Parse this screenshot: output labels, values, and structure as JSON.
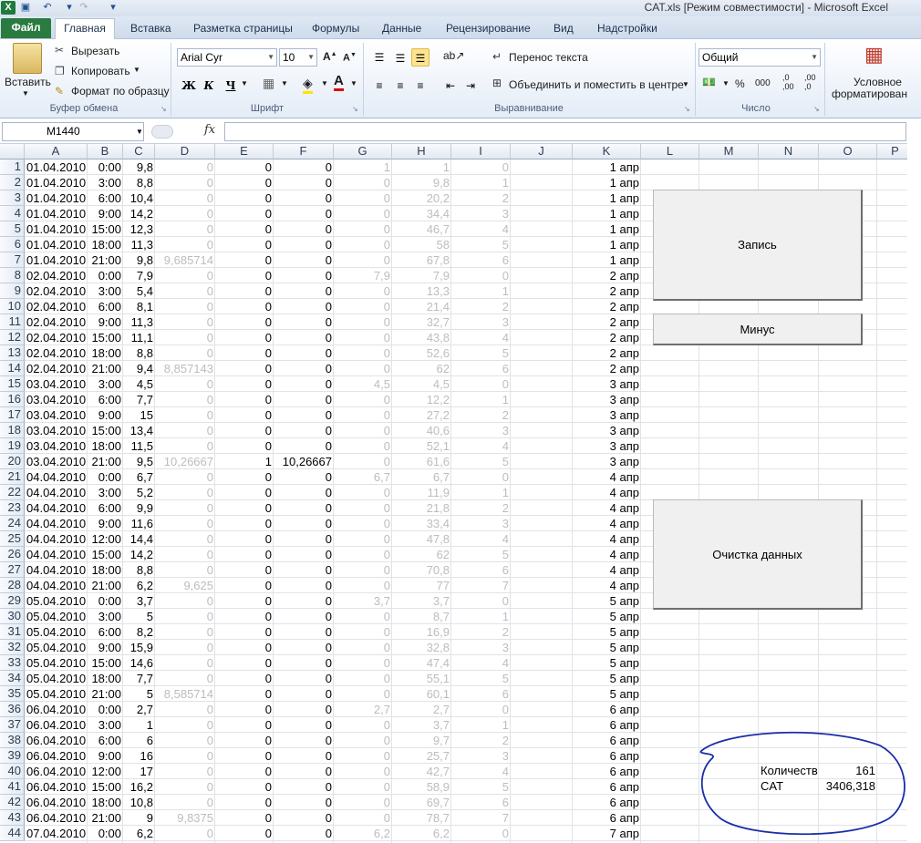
{
  "window": {
    "title": "CAT.xls  [Режим совместимости]  -  Microsoft Excel"
  },
  "ribbon": {
    "tabs": [
      "Файл",
      "Главная",
      "Вставка",
      "Разметка страницы",
      "Формулы",
      "Данные",
      "Рецензирование",
      "Вид",
      "Надстройки"
    ],
    "clipboard": {
      "paste": "Вставить",
      "cut": "Вырезать",
      "copy": "Копировать",
      "format_painter": "Формат по образцу",
      "group": "Буфер обмена"
    },
    "font": {
      "name": "Arial Cyr",
      "size": "10",
      "bold": "Ж",
      "italic": "К",
      "underline": "Ч",
      "group": "Шрифт"
    },
    "alignment": {
      "wrap": "Перенос текста",
      "merge": "Объединить и поместить в центре",
      "group": "Выравнивание"
    },
    "number": {
      "format": "Общий",
      "percent": "%",
      "thousands": "000",
      "inc_decimal": ",0\n,00",
      "dec_decimal": ",00\n,0",
      "group": "Число"
    },
    "styles": {
      "conditional": "Условное",
      "conditional2": "форматирован"
    }
  },
  "formula_bar": {
    "name_box": "M1440",
    "fx": "fx",
    "value": ""
  },
  "columns": [
    "A",
    "B",
    "C",
    "D",
    "E",
    "F",
    "G",
    "H",
    "I",
    "J",
    "K",
    "L",
    "M",
    "N",
    "O",
    "P"
  ],
  "rows": [
    {
      "n": "1",
      "a": "01.04.2010",
      "b": "0:00",
      "c": "9,8",
      "d": "0",
      "e": "0",
      "f": "0",
      "g": "1",
      "h": "1",
      "i": "0",
      "k": "1 апр"
    },
    {
      "n": "2",
      "a": "01.04.2010",
      "b": "3:00",
      "c": "8,8",
      "d": "0",
      "e": "0",
      "f": "0",
      "g": "0",
      "h": "9,8",
      "i": "1",
      "k": "1 апр"
    },
    {
      "n": "3",
      "a": "01.04.2010",
      "b": "6:00",
      "c": "10,4",
      "d": "0",
      "e": "0",
      "f": "0",
      "g": "0",
      "h": "20,2",
      "i": "2",
      "k": "1 апр"
    },
    {
      "n": "4",
      "a": "01.04.2010",
      "b": "9:00",
      "c": "14,2",
      "d": "0",
      "e": "0",
      "f": "0",
      "g": "0",
      "h": "34,4",
      "i": "3",
      "k": "1 апр"
    },
    {
      "n": "5",
      "a": "01.04.2010",
      "b": "15:00",
      "c": "12,3",
      "d": "0",
      "e": "0",
      "f": "0",
      "g": "0",
      "h": "46,7",
      "i": "4",
      "k": "1 апр"
    },
    {
      "n": "6",
      "a": "01.04.2010",
      "b": "18:00",
      "c": "11,3",
      "d": "0",
      "e": "0",
      "f": "0",
      "g": "0",
      "h": "58",
      "i": "5",
      "k": "1 апр"
    },
    {
      "n": "7",
      "a": "01.04.2010",
      "b": "21:00",
      "c": "9,8",
      "d": "9,685714",
      "e": "0",
      "f": "0",
      "g": "0",
      "h": "67,8",
      "i": "6",
      "k": "1 апр"
    },
    {
      "n": "8",
      "a": "02.04.2010",
      "b": "0:00",
      "c": "7,9",
      "d": "0",
      "e": "0",
      "f": "0",
      "g": "7,9",
      "h": "7,9",
      "i": "0",
      "k": "2 апр"
    },
    {
      "n": "9",
      "a": "02.04.2010",
      "b": "3:00",
      "c": "5,4",
      "d": "0",
      "e": "0",
      "f": "0",
      "g": "0",
      "h": "13,3",
      "i": "1",
      "k": "2 апр"
    },
    {
      "n": "10",
      "a": "02.04.2010",
      "b": "6:00",
      "c": "8,1",
      "d": "0",
      "e": "0",
      "f": "0",
      "g": "0",
      "h": "21,4",
      "i": "2",
      "k": "2 апр"
    },
    {
      "n": "11",
      "a": "02.04.2010",
      "b": "9:00",
      "c": "11,3",
      "d": "0",
      "e": "0",
      "f": "0",
      "g": "0",
      "h": "32,7",
      "i": "3",
      "k": "2 апр"
    },
    {
      "n": "12",
      "a": "02.04.2010",
      "b": "15:00",
      "c": "11,1",
      "d": "0",
      "e": "0",
      "f": "0",
      "g": "0",
      "h": "43,8",
      "i": "4",
      "k": "2 апр"
    },
    {
      "n": "13",
      "a": "02.04.2010",
      "b": "18:00",
      "c": "8,8",
      "d": "0",
      "e": "0",
      "f": "0",
      "g": "0",
      "h": "52,6",
      "i": "5",
      "k": "2 апр"
    },
    {
      "n": "14",
      "a": "02.04.2010",
      "b": "21:00",
      "c": "9,4",
      "d": "8,857143",
      "e": "0",
      "f": "0",
      "g": "0",
      "h": "62",
      "i": "6",
      "k": "2 апр"
    },
    {
      "n": "15",
      "a": "03.04.2010",
      "b": "3:00",
      "c": "4,5",
      "d": "0",
      "e": "0",
      "f": "0",
      "g": "4,5",
      "h": "4,5",
      "i": "0",
      "k": "3 апр"
    },
    {
      "n": "16",
      "a": "03.04.2010",
      "b": "6:00",
      "c": "7,7",
      "d": "0",
      "e": "0",
      "f": "0",
      "g": "0",
      "h": "12,2",
      "i": "1",
      "k": "3 апр"
    },
    {
      "n": "17",
      "a": "03.04.2010",
      "b": "9:00",
      "c": "15",
      "d": "0",
      "e": "0",
      "f": "0",
      "g": "0",
      "h": "27,2",
      "i": "2",
      "k": "3 апр"
    },
    {
      "n": "18",
      "a": "03.04.2010",
      "b": "15:00",
      "c": "13,4",
      "d": "0",
      "e": "0",
      "f": "0",
      "g": "0",
      "h": "40,6",
      "i": "3",
      "k": "3 апр"
    },
    {
      "n": "19",
      "a": "03.04.2010",
      "b": "18:00",
      "c": "11,5",
      "d": "0",
      "e": "0",
      "f": "0",
      "g": "0",
      "h": "52,1",
      "i": "4",
      "k": "3 апр"
    },
    {
      "n": "20",
      "a": "03.04.2010",
      "b": "21:00",
      "c": "9,5",
      "d": "10,26667",
      "e": "1",
      "f": "10,26667",
      "g": "0",
      "h": "61,6",
      "i": "5",
      "k": "3 апр"
    },
    {
      "n": "21",
      "a": "04.04.2010",
      "b": "0:00",
      "c": "6,7",
      "d": "0",
      "e": "0",
      "f": "0",
      "g": "6,7",
      "h": "6,7",
      "i": "0",
      "k": "4 апр"
    },
    {
      "n": "22",
      "a": "04.04.2010",
      "b": "3:00",
      "c": "5,2",
      "d": "0",
      "e": "0",
      "f": "0",
      "g": "0",
      "h": "11,9",
      "i": "1",
      "k": "4 апр"
    },
    {
      "n": "23",
      "a": "04.04.2010",
      "b": "6:00",
      "c": "9,9",
      "d": "0",
      "e": "0",
      "f": "0",
      "g": "0",
      "h": "21,8",
      "i": "2",
      "k": "4 апр"
    },
    {
      "n": "24",
      "a": "04.04.2010",
      "b": "9:00",
      "c": "11,6",
      "d": "0",
      "e": "0",
      "f": "0",
      "g": "0",
      "h": "33,4",
      "i": "3",
      "k": "4 апр"
    },
    {
      "n": "25",
      "a": "04.04.2010",
      "b": "12:00",
      "c": "14,4",
      "d": "0",
      "e": "0",
      "f": "0",
      "g": "0",
      "h": "47,8",
      "i": "4",
      "k": "4 апр"
    },
    {
      "n": "26",
      "a": "04.04.2010",
      "b": "15:00",
      "c": "14,2",
      "d": "0",
      "e": "0",
      "f": "0",
      "g": "0",
      "h": "62",
      "i": "5",
      "k": "4 апр"
    },
    {
      "n": "27",
      "a": "04.04.2010",
      "b": "18:00",
      "c": "8,8",
      "d": "0",
      "e": "0",
      "f": "0",
      "g": "0",
      "h": "70,8",
      "i": "6",
      "k": "4 апр"
    },
    {
      "n": "28",
      "a": "04.04.2010",
      "b": "21:00",
      "c": "6,2",
      "d": "9,625",
      "e": "0",
      "f": "0",
      "g": "0",
      "h": "77",
      "i": "7",
      "k": "4 апр"
    },
    {
      "n": "29",
      "a": "05.04.2010",
      "b": "0:00",
      "c": "3,7",
      "d": "0",
      "e": "0",
      "f": "0",
      "g": "3,7",
      "h": "3,7",
      "i": "0",
      "k": "5 апр"
    },
    {
      "n": "30",
      "a": "05.04.2010",
      "b": "3:00",
      "c": "5",
      "d": "0",
      "e": "0",
      "f": "0",
      "g": "0",
      "h": "8,7",
      "i": "1",
      "k": "5 апр"
    },
    {
      "n": "31",
      "a": "05.04.2010",
      "b": "6:00",
      "c": "8,2",
      "d": "0",
      "e": "0",
      "f": "0",
      "g": "0",
      "h": "16,9",
      "i": "2",
      "k": "5 апр"
    },
    {
      "n": "32",
      "a": "05.04.2010",
      "b": "9:00",
      "c": "15,9",
      "d": "0",
      "e": "0",
      "f": "0",
      "g": "0",
      "h": "32,8",
      "i": "3",
      "k": "5 апр"
    },
    {
      "n": "33",
      "a": "05.04.2010",
      "b": "15:00",
      "c": "14,6",
      "d": "0",
      "e": "0",
      "f": "0",
      "g": "0",
      "h": "47,4",
      "i": "4",
      "k": "5 апр"
    },
    {
      "n": "34",
      "a": "05.04.2010",
      "b": "18:00",
      "c": "7,7",
      "d": "0",
      "e": "0",
      "f": "0",
      "g": "0",
      "h": "55,1",
      "i": "5",
      "k": "5 апр"
    },
    {
      "n": "35",
      "a": "05.04.2010",
      "b": "21:00",
      "c": "5",
      "d": "8,585714",
      "e": "0",
      "f": "0",
      "g": "0",
      "h": "60,1",
      "i": "6",
      "k": "5 апр"
    },
    {
      "n": "36",
      "a": "06.04.2010",
      "b": "0:00",
      "c": "2,7",
      "d": "0",
      "e": "0",
      "f": "0",
      "g": "2,7",
      "h": "2,7",
      "i": "0",
      "k": "6 апр"
    },
    {
      "n": "37",
      "a": "06.04.2010",
      "b": "3:00",
      "c": "1",
      "d": "0",
      "e": "0",
      "f": "0",
      "g": "0",
      "h": "3,7",
      "i": "1",
      "k": "6 апр"
    },
    {
      "n": "38",
      "a": "06.04.2010",
      "b": "6:00",
      "c": "6",
      "d": "0",
      "e": "0",
      "f": "0",
      "g": "0",
      "h": "9,7",
      "i": "2",
      "k": "6 апр"
    },
    {
      "n": "39",
      "a": "06.04.2010",
      "b": "9:00",
      "c": "16",
      "d": "0",
      "e": "0",
      "f": "0",
      "g": "0",
      "h": "25,7",
      "i": "3",
      "k": "6 апр"
    },
    {
      "n": "40",
      "a": "06.04.2010",
      "b": "12:00",
      "c": "17",
      "d": "0",
      "e": "0",
      "f": "0",
      "g": "0",
      "h": "42,7",
      "i": "4",
      "k": "6 апр"
    },
    {
      "n": "41",
      "a": "06.04.2010",
      "b": "15:00",
      "c": "16,2",
      "d": "0",
      "e": "0",
      "f": "0",
      "g": "0",
      "h": "58,9",
      "i": "5",
      "k": "6 апр"
    },
    {
      "n": "42",
      "a": "06.04.2010",
      "b": "18:00",
      "c": "10,8",
      "d": "0",
      "e": "0",
      "f": "0",
      "g": "0",
      "h": "69,7",
      "i": "6",
      "k": "6 апр"
    },
    {
      "n": "43",
      "a": "06.04.2010",
      "b": "21:00",
      "c": "9",
      "d": "9,8375",
      "e": "0",
      "f": "0",
      "g": "0",
      "h": "78,7",
      "i": "7",
      "k": "6 апр"
    },
    {
      "n": "44",
      "a": "07.04.2010",
      "b": "0:00",
      "c": "6,2",
      "d": "0",
      "e": "0",
      "f": "0",
      "g": "6,2",
      "h": "6,2",
      "i": "0",
      "k": "7 апр"
    }
  ],
  "buttons": {
    "record": "Запись",
    "minus": "Минус",
    "clear": "Очистка данных"
  },
  "summary": {
    "count_label": "Количеств",
    "count_value": "161",
    "cat_label": "CAT",
    "cat_value": "3406,318"
  },
  "colors": {
    "file_tab": "#2a7b3f",
    "highlight": "#fbe48d",
    "annotation": "#1a2ea8",
    "grey_text": "#bdbdbd"
  }
}
